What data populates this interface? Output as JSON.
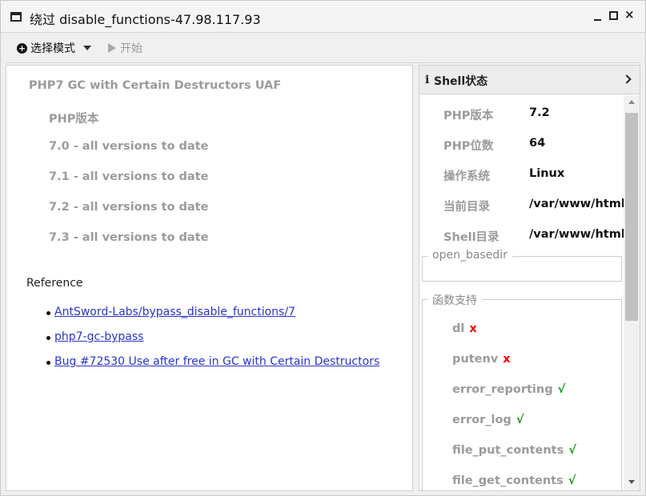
{
  "window": {
    "title": "绕过 disable_functions-47.98.117.93",
    "minimize_icon": "minimize-icon",
    "maximize_icon": "maximize-icon",
    "close_glyph": "×"
  },
  "toolbar": {
    "mode_label": "选择模式",
    "start_label": "开始"
  },
  "left": {
    "heading": "PHP7 GC with Certain Destructors UAF",
    "version_label": "PHP版本",
    "versions": [
      "7.0 - all versions to date",
      "7.1 - all versions to date",
      "7.2 - all versions to date",
      "7.3 - all versions to date"
    ],
    "reference_label": "Reference",
    "links": [
      "AntSword-Labs/bypass_disable_functions/7",
      "php7-gc-bypass",
      "Bug #72530 Use after free in GC with Certain Destructors"
    ]
  },
  "right": {
    "title": "Shell状态",
    "info": [
      {
        "key": "PHP版本",
        "value": "7.2"
      },
      {
        "key": "PHP位数",
        "value": "64"
      },
      {
        "key": "操作系统",
        "value": "Linux"
      },
      {
        "key": "当前目录",
        "value": "/var/www/html"
      },
      {
        "key": "Shell目录",
        "value": "/var/www/html"
      }
    ],
    "open_basedir_label": "open_basedir",
    "functions_label": "函数支持",
    "functions": [
      {
        "name": "dl",
        "mark": "x"
      },
      {
        "name": "putenv",
        "mark": "x"
      },
      {
        "name": "error_reporting",
        "mark": "√"
      },
      {
        "name": "error_log",
        "mark": "√"
      },
      {
        "name": "file_put_contents",
        "mark": "√"
      },
      {
        "name": "file_get_contents",
        "mark": "√"
      }
    ]
  },
  "colors": {
    "unsupported": "#e00000",
    "supported": "#1a9a1a",
    "link": "#2a35c5"
  }
}
